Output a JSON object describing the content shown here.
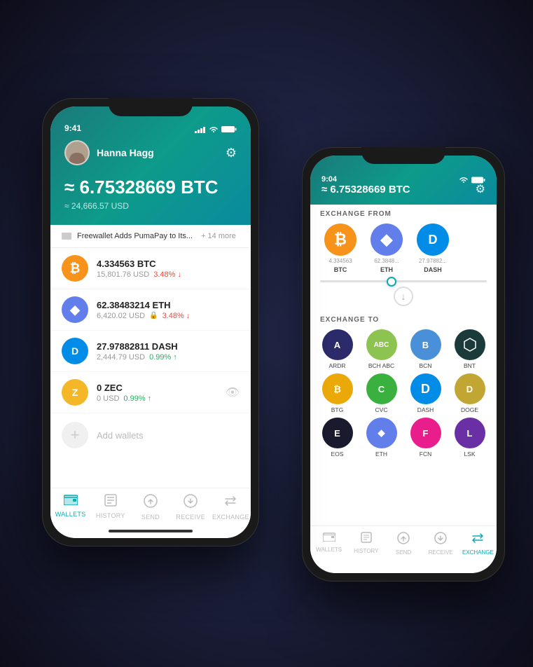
{
  "background": "#1a1a2e",
  "phone1": {
    "status_time": "9:41",
    "user": {
      "name": "Hanna Hagg"
    },
    "balance_btc": "≈ 6.75328669 BTC",
    "balance_usd": "≈ 24,666.57 USD",
    "news": {
      "text": "Freewallet Adds PumaPay to Its...",
      "more": "+ 14 more"
    },
    "wallets": [
      {
        "coin": "BTC",
        "amount": "4.334563 BTC",
        "usd": "15,801.76 USD",
        "pct": "3.48%",
        "dir": "down"
      },
      {
        "coin": "ETH",
        "amount": "62.38483214 ETH",
        "usd": "6,420.02 USD",
        "pct": "3.48%",
        "dir": "down",
        "locked": true
      },
      {
        "coin": "DASH",
        "amount": "27.97882811 DASH",
        "usd": "2,444.79 USD",
        "pct": "0.99%",
        "dir": "up"
      },
      {
        "coin": "ZEC",
        "amount": "0 ZEC",
        "usd": "0 USD",
        "pct": "0.99%",
        "dir": "up",
        "hidden": true
      }
    ],
    "add_wallets_label": "Add wallets",
    "nav": [
      {
        "label": "WALLETS",
        "icon": "wallet",
        "active": true
      },
      {
        "label": "HISTORY",
        "icon": "list",
        "active": false
      },
      {
        "label": "SEND",
        "icon": "send",
        "active": false
      },
      {
        "label": "RECEIVE",
        "icon": "receive",
        "active": false
      },
      {
        "label": "EXCHANGE",
        "icon": "exchange",
        "active": false
      }
    ]
  },
  "phone2": {
    "status_time": "9:04",
    "balance_btc": "≈ 6.75328669 BTC",
    "exchange_from_title": "EXCHANGE FROM",
    "from_coins": [
      {
        "symbol": "BTC",
        "amount": "4.334563",
        "name": "BTC",
        "type": "btc"
      },
      {
        "symbol": "ETH",
        "amount": "62.3848...",
        "name": "ETH",
        "type": "eth"
      },
      {
        "symbol": "DASH",
        "amount": "27.97882...",
        "name": "DASH",
        "type": "dash"
      }
    ],
    "exchange_to_title": "EXCHANGE TO",
    "to_coins": [
      {
        "symbol": "A",
        "label": "ARDR",
        "type": "gc-ardr"
      },
      {
        "symbol": "ABC",
        "label": "BCH ABC",
        "type": "gc-bch"
      },
      {
        "symbol": "B",
        "label": "BCN",
        "type": "gc-bcn"
      },
      {
        "symbol": "⬡",
        "label": "BNT",
        "type": "gc-bnt"
      },
      {
        "symbol": "₿",
        "label": "BTG",
        "type": "gc-btg"
      },
      {
        "symbol": "C",
        "label": "CVC",
        "type": "gc-cvc"
      },
      {
        "symbol": "D",
        "label": "DASH",
        "type": "gc-dash2"
      },
      {
        "symbol": "D",
        "label": "DOGE",
        "type": "gc-doge"
      },
      {
        "symbol": "E",
        "label": "EOS",
        "type": "gc-eos"
      },
      {
        "symbol": "◆",
        "label": "ETH",
        "type": "gc-eth2"
      },
      {
        "symbol": "F",
        "label": "FCN",
        "type": "gc-fcn"
      },
      {
        "symbol": "L",
        "label": "LSK",
        "type": "gc-lsk"
      }
    ],
    "nav": [
      {
        "label": "WALLETS",
        "icon": "wallet",
        "active": false
      },
      {
        "label": "HISTORY",
        "icon": "list",
        "active": false
      },
      {
        "label": "SEND",
        "icon": "send",
        "active": false
      },
      {
        "label": "RECEIVE",
        "icon": "receive",
        "active": false
      },
      {
        "label": "EXCHANGE",
        "icon": "exchange",
        "active": true
      }
    ]
  }
}
